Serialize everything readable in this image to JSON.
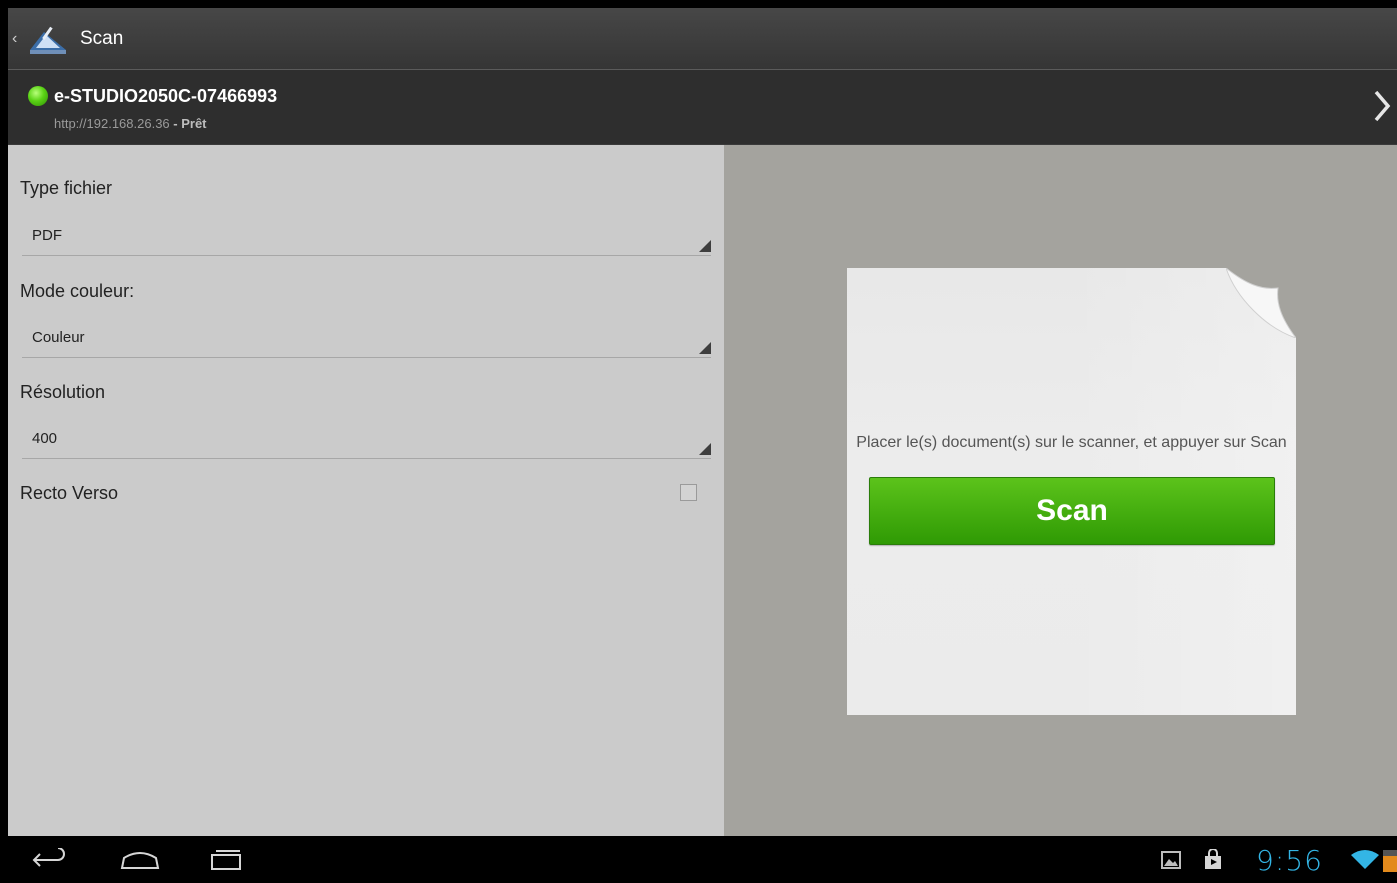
{
  "action_bar": {
    "title": "Scan",
    "up_icon": "chevron-left-icon",
    "app_icon": "scanner-icon"
  },
  "device": {
    "name": "e-STUDIO2050C-07466993",
    "url": "http://192.168.26.36",
    "separator": " - ",
    "status": "Prêt",
    "status_color": "#5ad315",
    "detail_icon": "chevron-right-icon"
  },
  "settings": {
    "file_type": {
      "label": "Type fichier",
      "value": "PDF"
    },
    "color_mode": {
      "label": "Mode couleur:",
      "value": "Couleur"
    },
    "resolution": {
      "label": "Résolution",
      "value": "400"
    },
    "duplex": {
      "label": "Recto Verso",
      "checked": false
    }
  },
  "preview": {
    "instructions": "Placer le(s) document(s) sur le scanner, et appuyer sur Scan",
    "scan_button": "Scan",
    "scan_button_color": "#3aa80a"
  },
  "system_bar": {
    "time": "9:56",
    "clock_color": "#33b5e5",
    "nav_icons": [
      "back-icon",
      "home-icon",
      "recent-apps-icon"
    ],
    "tray_icons": [
      "gallery-notification-icon",
      "store-notification-icon",
      "wifi-icon",
      "battery-icon"
    ]
  }
}
